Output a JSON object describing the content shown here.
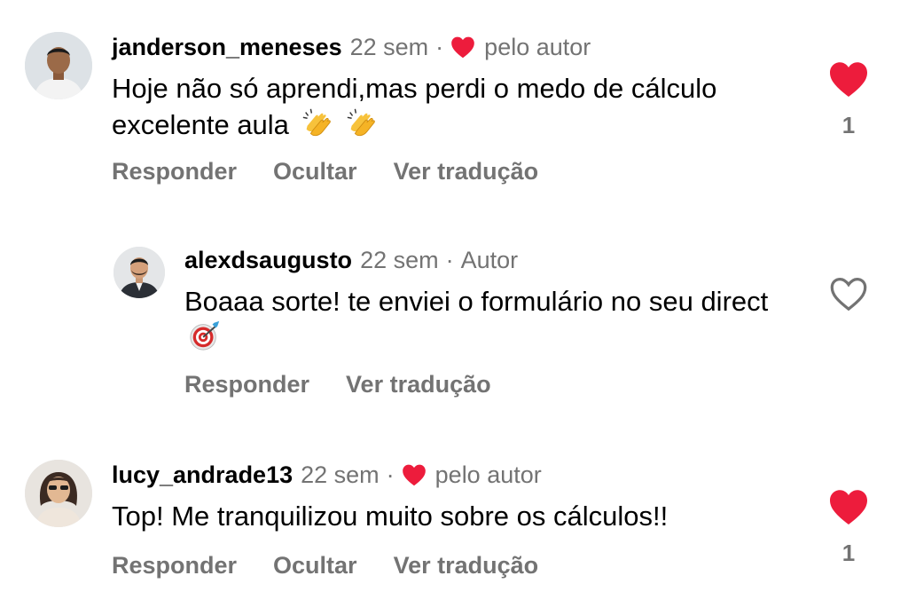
{
  "comments": [
    {
      "username": "janderson_meneses",
      "time": "22 sem",
      "separator": "·",
      "liked_by_author_label": "pelo autor",
      "text": "Hoje não só aprendi,mas perdi o medo de cálculo excelente aula",
      "emojis": [
        "clapping-hands",
        "clapping-hands"
      ],
      "liked": true,
      "like_count": "1",
      "actions": {
        "reply": "Responder",
        "hide": "Ocultar",
        "translate": "Ver tradução"
      }
    },
    {
      "username": "alexdsaugusto",
      "time": "22 sem",
      "separator": "·",
      "author_badge": "Autor",
      "text": "Boaaa sorte! te enviei o formulário no seu direct",
      "emojis": [
        "direct-hit"
      ],
      "liked": false,
      "actions": {
        "reply": "Responder",
        "translate": "Ver tradução"
      }
    },
    {
      "username": "lucy_andrade13",
      "time": "22 sem",
      "separator": "·",
      "liked_by_author_label": "pelo autor",
      "text": "Top! Me tranquilizou muito sobre os cálculos!!",
      "liked": true,
      "like_count": "1",
      "actions": {
        "reply": "Responder",
        "hide": "Ocultar",
        "translate": "Ver tradução"
      }
    }
  ],
  "colors": {
    "heart_red": "#ed1c3c",
    "muted_text": "#737373",
    "text": "#000000",
    "background": "#ffffff"
  }
}
